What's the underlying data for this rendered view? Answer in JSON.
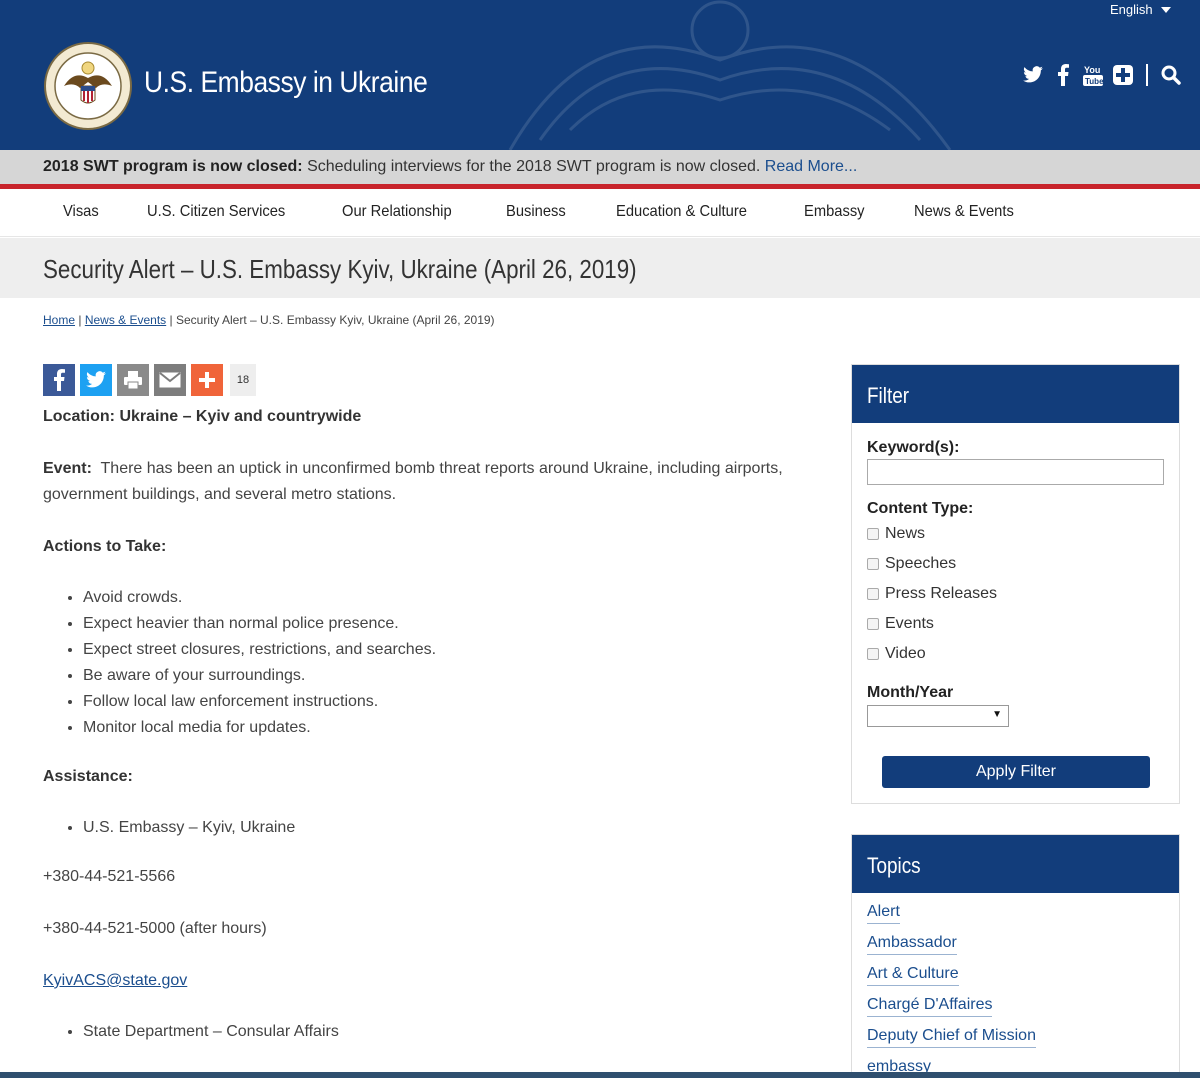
{
  "header": {
    "site_title": "U.S. Embassy in Ukraine",
    "language": "English"
  },
  "alert": {
    "bold": "2018 SWT program is now closed:",
    "text": " Scheduling interviews for the 2018 SWT program is now closed. ",
    "link": "Read More..."
  },
  "nav": [
    "Visas",
    "U.S. Citizen Services",
    "Our Relationship",
    "Business",
    "Education & Culture",
    "Embassy",
    "News & Events"
  ],
  "page": {
    "title": "Security Alert – U.S. Embassy Kyiv, Ukraine (April 26, 2019)"
  },
  "breadcrumb": {
    "home": "Home",
    "section": "News & Events",
    "current": "Security Alert – U.S. Embassy Kyiv, Ukraine (April 26, 2019)"
  },
  "share": {
    "count": "18"
  },
  "content": {
    "location": "Location: Ukraine – Kyiv and countrywide",
    "event_label": "Event:",
    "event_line1": "There has been an uptick in unconfirmed bomb threat reports around Ukraine, including airports,",
    "event_line2": "government buildings, and several metro stations.",
    "actions_label": "Actions to Take:",
    "actions": [
      "Avoid crowds.",
      "Expect heavier than normal police presence.",
      "Expect street closures, restrictions, and searches.",
      "Be aware of your surroundings.",
      "Follow local law enforcement instructions.",
      "Monitor local media for updates."
    ],
    "assistance_label": "Assistance:",
    "embassy": "U.S. Embassy – Kyiv, Ukraine",
    "phone1": "+380-44-521-5566",
    "phone2": "+380-44-521-5000 (after hours)",
    "email": "KyivACS@state.gov",
    "consular": "State Department – Consular Affairs"
  },
  "filter": {
    "title": "Filter",
    "keyword_label": "Keyword(s):",
    "keyword_value": "",
    "content_type_label": "Content Type:",
    "types": [
      "News",
      "Speeches",
      "Press Releases",
      "Events",
      "Video"
    ],
    "month_label": "Month/Year",
    "month_value": "",
    "apply": "Apply Filter"
  },
  "topics": {
    "title": "Topics",
    "items": [
      "Alert",
      "Ambassador",
      "Art & Culture",
      "Chargé D'Affaires",
      "Deputy Chief of Mission",
      "embassy"
    ]
  },
  "colors": {
    "navy": "#123d7b",
    "alert_red": "#c8242b",
    "link": "#1b4e8e"
  }
}
